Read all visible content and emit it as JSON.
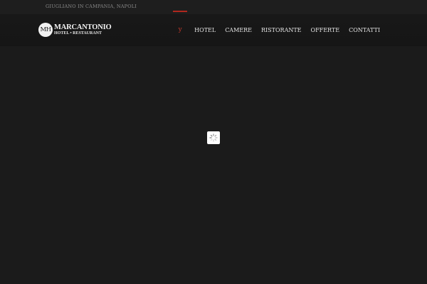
{
  "topbar": {
    "location": "GIUGLIANO IN CAMPANIA, NAPOLI"
  },
  "header": {
    "logo": {
      "monogram": "MH",
      "name": "MARCANTONIO",
      "tagline": "HOTEL • RESTAURANT"
    },
    "nav": {
      "home_glyph": "y",
      "items": [
        {
          "label": "HOTEL"
        },
        {
          "label": "CAMERE"
        },
        {
          "label": "RISTORANTE"
        },
        {
          "label": "OFFERTE"
        },
        {
          "label": "CONTATTI"
        }
      ]
    }
  },
  "loader": {
    "icon": "spinner-icon"
  },
  "colors": {
    "background": "#1b1b1b",
    "header": "#161616",
    "accent": "#b0281e",
    "nav_text": "#e6e6e6"
  }
}
